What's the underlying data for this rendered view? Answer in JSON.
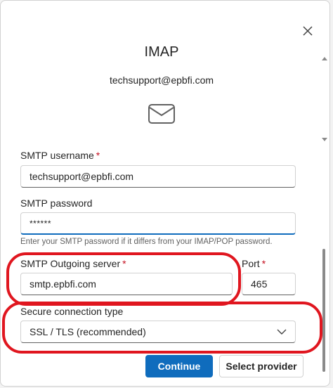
{
  "dialog": {
    "title": "IMAP",
    "account_email": "techsupport@epbfi.com"
  },
  "icons": {
    "close": "close-icon",
    "mail": "mail-envelope-icon",
    "chevron": "chevron-down-icon"
  },
  "smtp_username": {
    "label": "SMTP username",
    "required": "*",
    "value": "techsupport@epbfi.com"
  },
  "smtp_password": {
    "label": "SMTP password",
    "value": "******",
    "hint": "Enter your SMTP password if it differs from your IMAP/POP password."
  },
  "smtp_server": {
    "label": "SMTP Outgoing server",
    "required": "*",
    "value": "smtp.epbfi.com"
  },
  "port": {
    "label": "Port",
    "required": "*",
    "value": "465"
  },
  "secure_connection": {
    "label": "Secure connection type",
    "selected": "SSL / TLS (recommended)"
  },
  "buttons": {
    "continue": "Continue",
    "select_provider": "Select provider"
  },
  "colors": {
    "primary": "#0f6cbd",
    "required": "#c50f1f",
    "annotation": "#e0161f"
  }
}
